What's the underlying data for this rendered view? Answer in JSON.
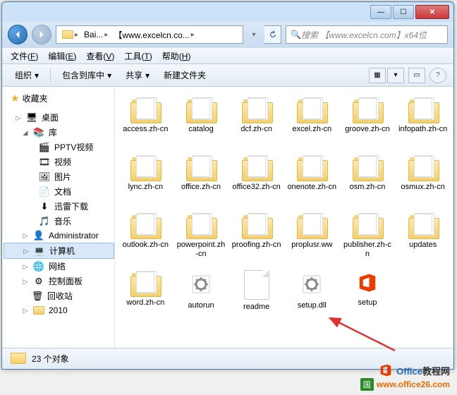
{
  "window": {
    "titlebar": {
      "min": "—",
      "max": "☐",
      "close": "✕"
    }
  },
  "address": {
    "back_icon": "nav-back",
    "segments": [
      "Bai...",
      "【www.excelcn.co..."
    ],
    "search_icon": "🔍",
    "search_placeholder": "搜索 【www.excelcn.com】x64位"
  },
  "menu": [
    {
      "label": "文件",
      "key": "F"
    },
    {
      "label": "编辑",
      "key": "E"
    },
    {
      "label": "查看",
      "key": "V"
    },
    {
      "label": "工具",
      "key": "T"
    },
    {
      "label": "帮助",
      "key": "H"
    }
  ],
  "toolbar": {
    "organize": "组织",
    "include": "包含到库中",
    "share": "共享",
    "new_folder": "新建文件夹"
  },
  "sidebar": {
    "favorites": "收藏夹",
    "desktop": "桌面",
    "library": "库",
    "lib_items": [
      "PPTV视频",
      "视频",
      "图片",
      "文档",
      "迅雷下载",
      "音乐"
    ],
    "admin": "Administrator",
    "computer": "计算机",
    "network": "网络",
    "control": "控制面板",
    "recycle": "回收站",
    "y2010": "2010"
  },
  "items": [
    {
      "name": "access.zh-cn",
      "type": "folder"
    },
    {
      "name": "catalog",
      "type": "folder"
    },
    {
      "name": "dcf.zh-cn",
      "type": "folder"
    },
    {
      "name": "excel.zh-cn",
      "type": "folder"
    },
    {
      "name": "groove.zh-cn",
      "type": "folder"
    },
    {
      "name": "infopath.zh-cn",
      "type": "folder"
    },
    {
      "name": "lync.zh-cn",
      "type": "folder"
    },
    {
      "name": "office.zh-cn",
      "type": "folder"
    },
    {
      "name": "office32.zh-cn",
      "type": "folder"
    },
    {
      "name": "onenote.zh-cn",
      "type": "folder"
    },
    {
      "name": "osm.zh-cn",
      "type": "folder"
    },
    {
      "name": "osmux.zh-cn",
      "type": "folder"
    },
    {
      "name": "outlook.zh-cn",
      "type": "folder"
    },
    {
      "name": "powerpoint.zh-cn",
      "type": "folder"
    },
    {
      "name": "proofing.zh-cn",
      "type": "folder"
    },
    {
      "name": "proplusr.ww",
      "type": "folder"
    },
    {
      "name": "publisher.zh-cn",
      "type": "folder"
    },
    {
      "name": "updates",
      "type": "folder"
    },
    {
      "name": "word.zh-cn",
      "type": "folder"
    },
    {
      "name": "autorun",
      "type": "gear"
    },
    {
      "name": "readme",
      "type": "file"
    },
    {
      "name": "setup.dll",
      "type": "gear"
    },
    {
      "name": "setup",
      "type": "office"
    }
  ],
  "status": {
    "count": "23 个对象"
  },
  "watermark": {
    "brand_o": "O",
    "brand_office": "Office",
    "brand_rest": "教程网",
    "badge": "国",
    "url": "www.office26.com"
  }
}
